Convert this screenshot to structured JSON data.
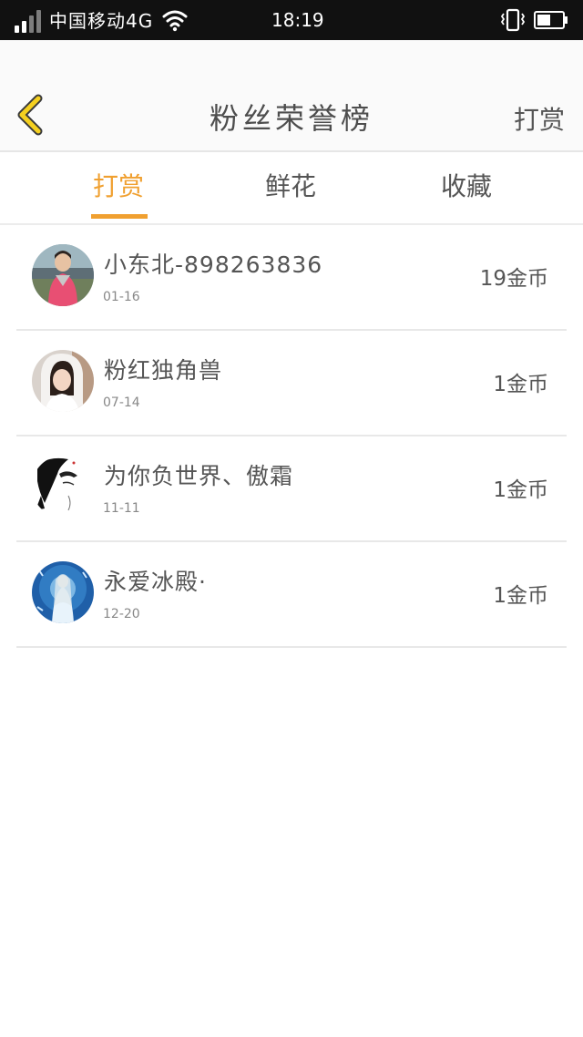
{
  "status_bar": {
    "carrier": "中国移动4G",
    "time": "18:19"
  },
  "header": {
    "title": "粉丝荣誉榜",
    "right_action": "打赏"
  },
  "tabs": [
    {
      "label": "打赏",
      "active": true
    },
    {
      "label": "鲜花",
      "active": false
    },
    {
      "label": "收藏",
      "active": false
    }
  ],
  "fans": [
    {
      "name": "小东北-898263836",
      "date": "01-16",
      "coins": "19金币"
    },
    {
      "name": "粉红独角兽",
      "date": "07-14",
      "coins": "1金币"
    },
    {
      "name": "为你负世界、傲霜",
      "date": "11-11",
      "coins": "1金币"
    },
    {
      "name": "永爱冰殿·",
      "date": "12-20",
      "coins": "1金币"
    }
  ],
  "colors": {
    "accent": "#f0a030",
    "back_arrow": "#f5d020",
    "status_bar_bg": "#111111"
  }
}
